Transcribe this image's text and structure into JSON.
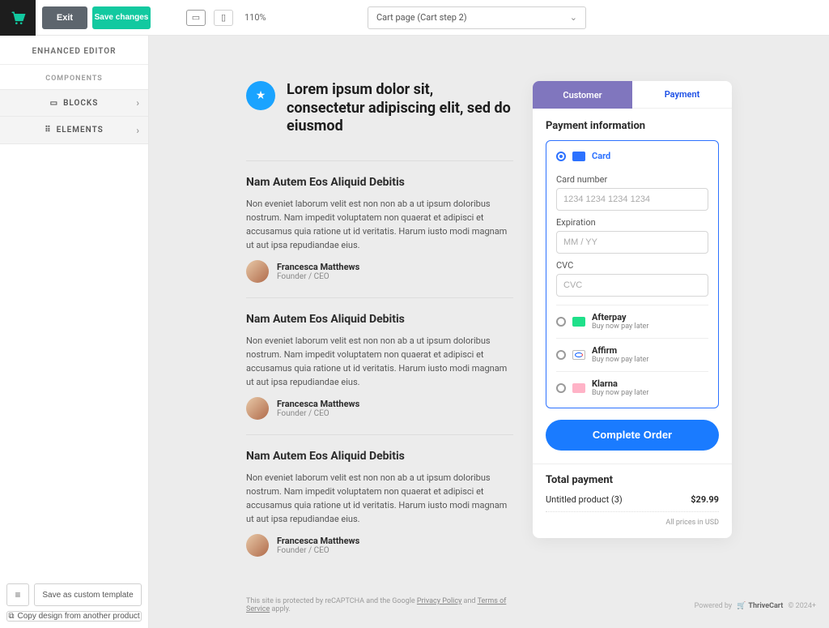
{
  "header": {
    "exit": "Exit",
    "save": "Save changes",
    "zoom": "110%",
    "page_select": "Cart page (Cart step 2)"
  },
  "sidebar": {
    "title": "ENHANCED EDITOR",
    "components": "COMPONENTS",
    "blocks": "BLOCKS",
    "elements": "ELEMENTS",
    "save_template": "Save as custom template",
    "copy_design": "Copy design from another product"
  },
  "hero": {
    "title": "Lorem ipsum dolor sit, consectetur adipiscing elit, sed do eiusmod"
  },
  "testimonials": [
    {
      "heading": "Nam Autem Eos Aliquid Debitis",
      "body": "Non eveniet laborum velit est non non ab a ut ipsum doloribus nostrum. Nam impedit voluptatem non quaerat et adipisci et accusamus quia ratione ut id veritatis. Harum iusto modi magnam ut aut ipsa repudiandae eius.",
      "name": "Francesca Matthews",
      "role": "Founder / CEO"
    },
    {
      "heading": "Nam Autem Eos Aliquid Debitis",
      "body": "Non eveniet laborum velit est non non ab a ut ipsum doloribus nostrum. Nam impedit voluptatem non quaerat et adipisci et accusamus quia ratione ut id veritatis. Harum iusto modi magnam ut aut ipsa repudiandae eius.",
      "name": "Francesca Matthews",
      "role": "Founder / CEO"
    },
    {
      "heading": "Nam Autem Eos Aliquid Debitis",
      "body": "Non eveniet laborum velit est non non ab a ut ipsum doloribus nostrum. Nam impedit voluptatem non quaerat et adipisci et accusamus quia ratione ut id veritatis. Harum iusto modi magnam ut aut ipsa repudiandae eius.",
      "name": "Francesca Matthews",
      "role": "Founder / CEO"
    }
  ],
  "footer": {
    "prefix": "This site is protected by reCAPTCHA and the Google ",
    "privacy": "Privacy Policy",
    "and": " and ",
    "terms": "Terms of Service",
    "suffix": " apply."
  },
  "checkout": {
    "tabs": {
      "customer": "Customer",
      "payment": "Payment"
    },
    "heading": "Payment information",
    "methods": {
      "card": "Card",
      "afterpay": {
        "name": "Afterpay",
        "sub": "Buy now pay later"
      },
      "affirm": {
        "name": "Affirm",
        "sub": "Buy now pay later"
      },
      "klarna": {
        "name": "Klarna",
        "sub": "Buy now pay later"
      }
    },
    "fields": {
      "card_number": {
        "label": "Card number",
        "placeholder": "1234 1234 1234 1234"
      },
      "expiration": {
        "label": "Expiration",
        "placeholder": "MM / YY"
      },
      "cvc": {
        "label": "CVC",
        "placeholder": "CVC"
      }
    },
    "complete": "Complete Order",
    "total_heading": "Total payment",
    "line_item": {
      "name": "Untitled product (3)",
      "price": "$29.99"
    },
    "currency": "All prices in USD"
  },
  "powered": {
    "prefix": "Powered by",
    "brand": "ThriveCart",
    "year": "© 2024+"
  }
}
